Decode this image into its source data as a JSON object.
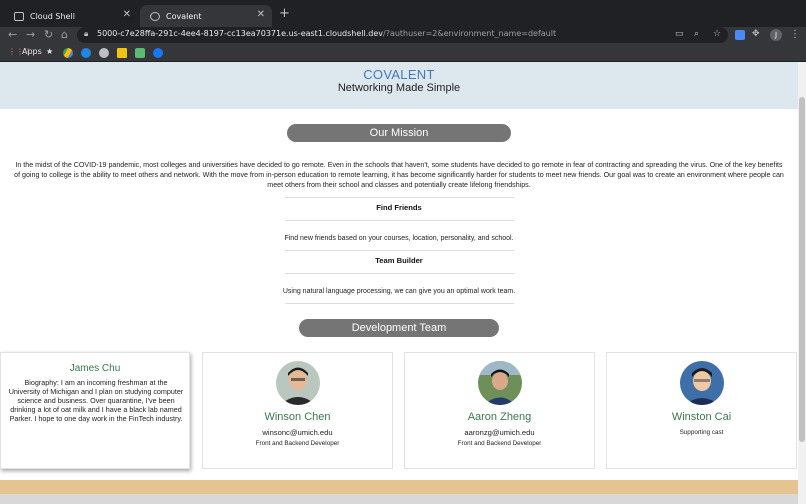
{
  "browser": {
    "tabs": [
      {
        "title": "Cloud Shell",
        "active": false
      },
      {
        "title": "Covalent",
        "active": true
      }
    ],
    "url_host": "5000-c7e28ffa-291c-4ee4-8197-cc13ea70371e.us-east1.cloudshell.dev",
    "url_rest": "/?authuser=2&environment_name=default",
    "profile_initial": "J",
    "bookmarks": [
      {
        "label": "Apps",
        "icon": "apps-grid-icon"
      },
      {
        "label": "",
        "icon": "star-icon"
      },
      {
        "label": "",
        "icon": "drive-icon"
      },
      {
        "label": "",
        "icon": "messenger-icon"
      },
      {
        "label": "",
        "icon": "globe-icon"
      },
      {
        "label": "",
        "icon": "michigan-m-icon"
      },
      {
        "label": "",
        "icon": "palm-icon"
      },
      {
        "label": "",
        "icon": "facebook-icon"
      }
    ]
  },
  "site": {
    "brand": "COVALENT",
    "tagline": "Networking Made Simple",
    "mission_heading": "Our Mission",
    "mission_text": "In the midst of the COVID-19 pandemic, most colleges and universities have decided to go remote. Even in the schools that haven't, some students have decided to go remote in fear of contracting and spreading the virus. One of the key benefits of going to college is the ability to meet others and network. With the move from in-person education to remote learning, it has become significantly harder for students to meet new friends. Our goal was to create an environment where people can meet others from their school and classes and potentially create lifelong friendships.",
    "features": [
      {
        "title": "Find Friends",
        "desc": "Find new friends based on your courses, location, personality, and school."
      },
      {
        "title": "Team Builder",
        "desc": "Using natural language processing, we can give you an optimal work team."
      }
    ],
    "team_heading": "Development Team",
    "team": [
      {
        "name": "James Chu",
        "bio": "Biography: I am an incoming freshman at the University of Michigan and I plan on studying computer science and business. Over quarantine, I've been drinking a lot of oat milk and I have a black lab named Parker. I hope to one day work in the FinTech industry."
      },
      {
        "name": "Winson Chen",
        "email": "winsonc@umich.edu",
        "role": "Front and Backend Developer"
      },
      {
        "name": "Aaron Zheng",
        "email": "aaronzg@umich.edu",
        "role": "Front and Backend Developer"
      },
      {
        "name": "Winston Cai",
        "role": "Supporting cast"
      }
    ]
  },
  "colors": {
    "brand": "#4479b3",
    "hero_bg": "#dde8ee",
    "pill_bg": "#757575",
    "name_green": "#3a7a4a",
    "footer": "#e6c48f"
  }
}
